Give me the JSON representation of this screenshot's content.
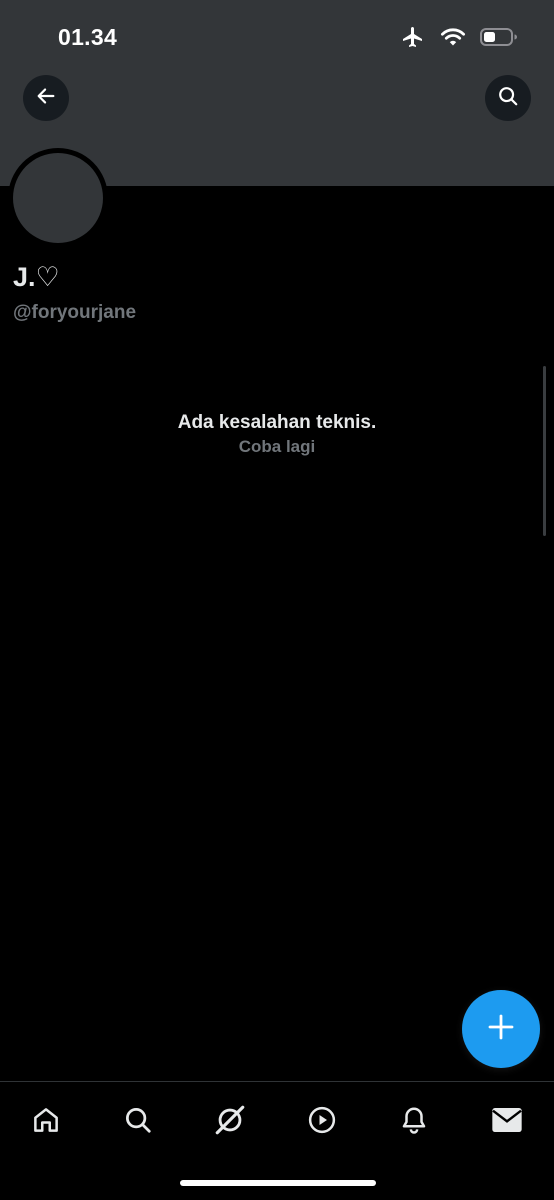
{
  "status_bar": {
    "time": "01.34",
    "icons": [
      "airplane-icon",
      "wifi-icon",
      "battery-icon"
    ]
  },
  "header": {
    "back_icon": "arrow-left-icon",
    "search_icon": "search-icon"
  },
  "profile": {
    "display_name": "J.♡",
    "handle": "@foryourjane"
  },
  "error": {
    "title": "Ada kesalahan teknis.",
    "retry": "Coba lagi"
  },
  "fab": {
    "icon": "plus-icon"
  },
  "bottom_nav": {
    "items": [
      "home-icon",
      "search-icon",
      "grok-icon",
      "video-icon",
      "notifications-icon",
      "messages-icon"
    ]
  },
  "colors": {
    "accent": "#1d9bf0",
    "banner": "#333639",
    "background": "#000000",
    "secondary_text": "#71767b"
  }
}
